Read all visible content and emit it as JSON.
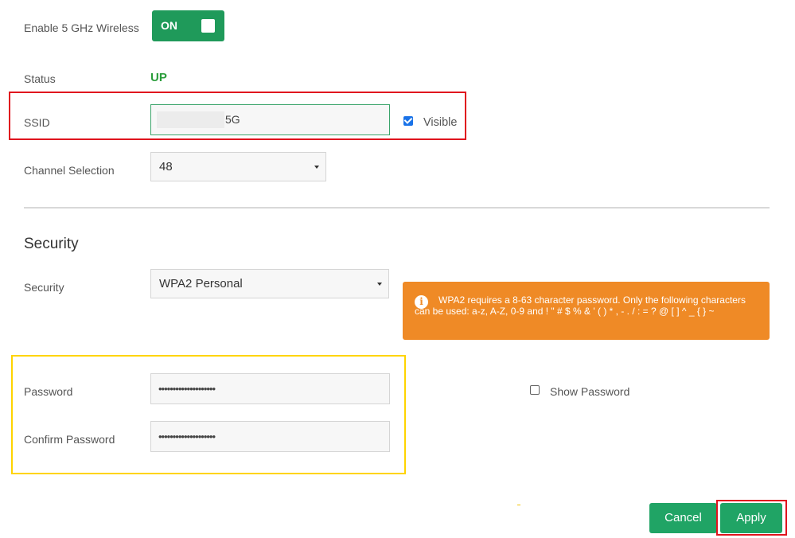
{
  "wireless": {
    "enable_label": "Enable 5 GHz Wireless",
    "toggle_state": "ON"
  },
  "status": {
    "label": "Status",
    "value": "UP"
  },
  "ssid": {
    "label": "SSID",
    "value_visible_suffix": "5G",
    "visible_label": "Visible",
    "visible_checked": true
  },
  "channel": {
    "label": "Channel Selection",
    "value": "48"
  },
  "security_section": {
    "title": "Security",
    "label": "Security",
    "value": "WPA2 Personal",
    "alert": "WPA2 requires a 8-63 character password. Only the following characters can be used: a-z, A-Z, 0-9 and ! \" # $ % & ' ( ) * , - . / : = ? @ [ ] ^ _ { } ~"
  },
  "password": {
    "label": "Password",
    "masked_value": "••••••••••••••••••••",
    "confirm_label": "Confirm Password",
    "confirm_masked_value": "••••••••••••••••••••",
    "show_label": "Show Password",
    "show_checked": false
  },
  "actions": {
    "cancel_label": "Cancel",
    "apply_label": "Apply"
  },
  "colors": {
    "primary_green": "#20a465",
    "status_green": "#2a9d3b",
    "alert_orange": "#ef8a26",
    "highlight_red": "#e0141e",
    "highlight_yellow": "#ffd400"
  }
}
